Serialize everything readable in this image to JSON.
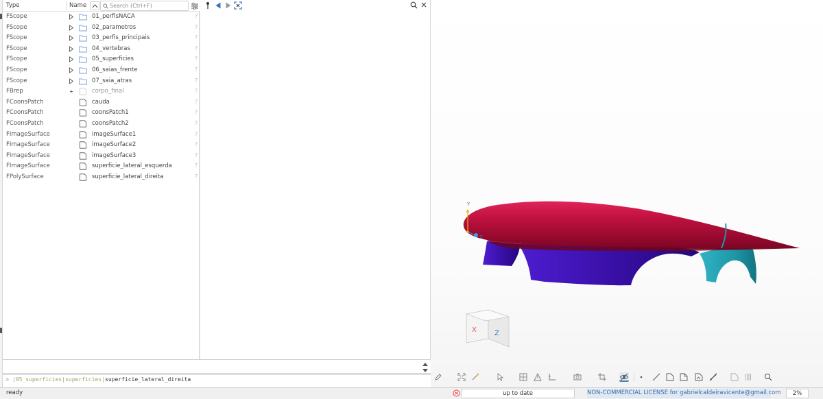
{
  "tree": {
    "header": {
      "type_label": "Type",
      "name_label": "Name",
      "search_placeholder": "Search (Ctrl+F)",
      "search_value": ""
    },
    "rows": [
      {
        "type": "FScope",
        "name": "01_perfisNACA",
        "kind": "folder"
      },
      {
        "type": "FScope",
        "name": "02_parametros",
        "kind": "folder"
      },
      {
        "type": "FScope",
        "name": "03_perfis_principais",
        "kind": "folder"
      },
      {
        "type": "FScope",
        "name": "04_vertebras",
        "kind": "folder"
      },
      {
        "type": "FScope",
        "name": "05_superficies",
        "kind": "folder"
      },
      {
        "type": "FScope",
        "name": "06_saias_frente",
        "kind": "folder"
      },
      {
        "type": "FScope",
        "name": "07_saia_atras",
        "kind": "folder"
      },
      {
        "type": "FBrep",
        "name": "corpo_final",
        "kind": "hidden"
      },
      {
        "type": "FCoonsPatch",
        "name": "cauda",
        "kind": "item"
      },
      {
        "type": "FCoonsPatch",
        "name": "coonsPatch1",
        "kind": "item"
      },
      {
        "type": "FCoonsPatch",
        "name": "coonsPatch2",
        "kind": "item"
      },
      {
        "type": "FImageSurface",
        "name": "imageSurface1",
        "kind": "item"
      },
      {
        "type": "FImageSurface",
        "name": "imageSurface2",
        "kind": "item"
      },
      {
        "type": "FImageSurface",
        "name": "imageSurface3",
        "kind": "item"
      },
      {
        "type": "FImageSurface",
        "name": "superficie_lateral_esquerda",
        "kind": "item"
      },
      {
        "type": "FPolySurface",
        "name": "superficie_lateral_direita",
        "kind": "item"
      }
    ],
    "row_status": "?"
  },
  "console": {
    "prompt": ">",
    "path_dim": "|05_superficies|superficies|",
    "path_main": "superficie_lateral_direita"
  },
  "viewport": {
    "axis_y": "Y",
    "axis_z": "Z",
    "cube_x": "X",
    "cube_z": "Z",
    "colors": {
      "body": "#c0113f",
      "side_skirt": "#3a10a8",
      "rear_skirt": "#1f98a8"
    }
  },
  "status": {
    "ready": "ready",
    "update": "up to date",
    "license": "NON-COMMERCIAL LICENSE for gabrielcaldeiravicente@gmail.com",
    "zoom": "2%"
  },
  "icons": {
    "mid_toolbar": [
      "pin-icon",
      "back-arrow-icon",
      "forward-arrow-icon",
      "fit-selection-icon",
      "search-icon",
      "close-icon"
    ],
    "viewport_toolbar": [
      "pencil-icon",
      "fit-all-icon",
      "magic-icon",
      "pointer-icon",
      "grid-icon",
      "triangle-icon",
      "angle-icon",
      "camera-icon",
      "crop-icon",
      "visibility-icon",
      "point-icon",
      "line-icon",
      "surface-icon",
      "surface-copy-icon",
      "image-icon",
      "curve-icon",
      "face-icon",
      "bars-icon",
      "zoom-icon"
    ]
  }
}
